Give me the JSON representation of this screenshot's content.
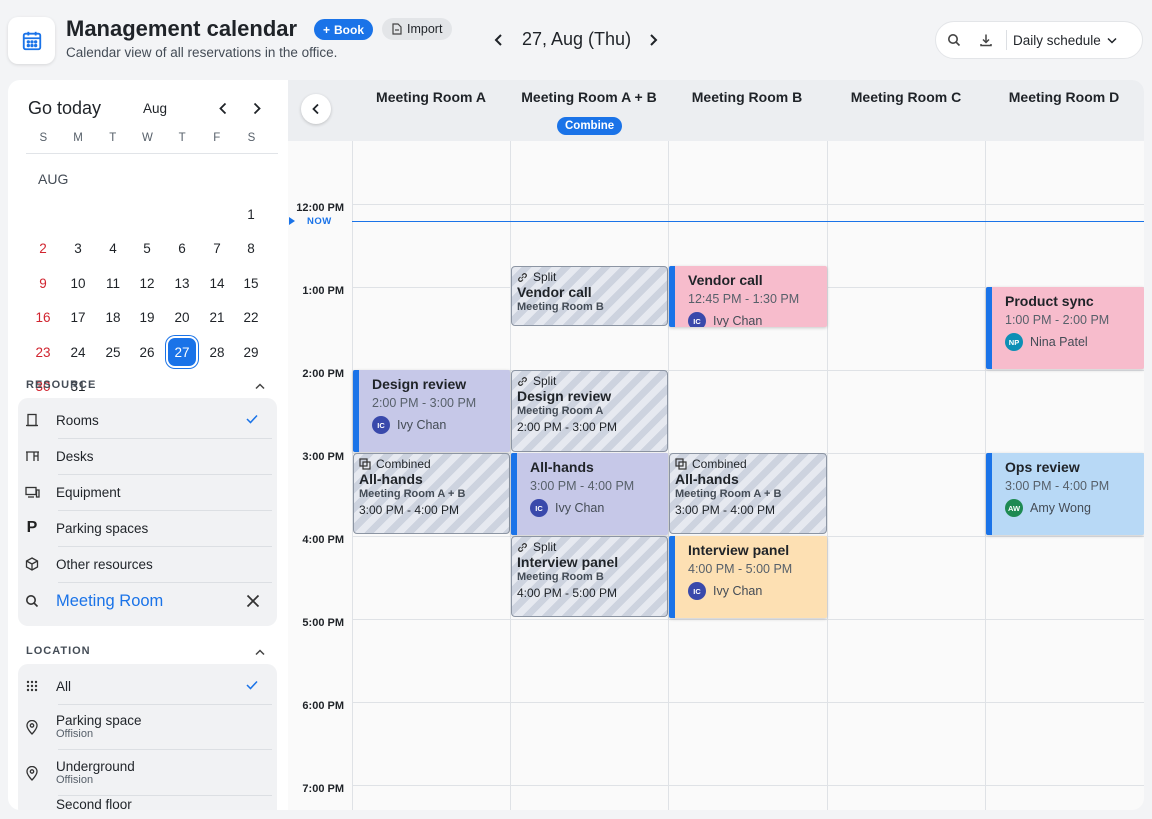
{
  "header": {
    "title": "Management calendar",
    "subtitle": "Calendar view of all reservations in the office.",
    "book_label": "Book",
    "import_label": "Import",
    "date": "27, Aug (Thu)",
    "view_select": "Daily schedule",
    "icons": [
      "calendar-icon",
      "plus-icon",
      "file-icon",
      "chevron-left-icon",
      "chevron-right-icon",
      "search-icon",
      "download-icon",
      "chevron-down-icon"
    ]
  },
  "mini_calendar": {
    "go_today": "Go today",
    "month_select": "Aug",
    "weekdays": [
      "S",
      "M",
      "T",
      "W",
      "T",
      "F",
      "S"
    ],
    "month_tag": "AUG",
    "selected_day": "27",
    "accent": "#1a73e8",
    "sunday_color": "#d1242f"
  },
  "resource": {
    "label": "RESOURCE",
    "items": [
      {
        "label": "Rooms",
        "icon": "door-icon",
        "checked": true
      },
      {
        "label": "Desks",
        "icon": "desk-icon",
        "checked": false
      },
      {
        "label": "Equipment",
        "icon": "monitor-icon",
        "checked": false
      },
      {
        "label": "Parking spaces",
        "icon": "parking-icon",
        "checked": false
      },
      {
        "label": "Other resources",
        "icon": "box-icon",
        "checked": false
      }
    ],
    "search_value": "Meeting Room"
  },
  "location": {
    "label": "LOCATION",
    "items": [
      {
        "label": "All",
        "sub": "",
        "icon": "grid-dots-icon",
        "checked": true
      },
      {
        "label": "Parking space",
        "sub": "Offision",
        "icon": "pin-icon"
      },
      {
        "label": "Underground",
        "sub": "Offision",
        "icon": "pin-icon"
      },
      {
        "label": "Second floor",
        "sub": "",
        "icon": "pin-icon"
      }
    ]
  },
  "calendar": {
    "rooms": [
      "Meeting Room A",
      "Meeting Room A + B",
      "Meeting Room B",
      "Meeting Room C",
      "Meeting Room D"
    ],
    "combine_label": "Combine",
    "times": [
      "12:00 PM",
      "1:00 PM",
      "2:00 PM",
      "3:00 PM",
      "4:00 PM",
      "5:00 PM",
      "6:00 PM",
      "7:00 PM"
    ],
    "now_label": "NOW",
    "events": {
      "vendor_call_b": {
        "title": "Vendor call",
        "time": "12:45 PM - 1:30 PM",
        "initials": "IC",
        "person": "Ivy Chan"
      },
      "product_sync": {
        "title": "Product sync",
        "time": "1:00 PM - 2:00 PM",
        "initials": "NP",
        "person": "Nina Patel"
      },
      "design_review_a": {
        "title": "Design review",
        "time": "2:00 PM - 3:00 PM",
        "initials": "IC",
        "person": "Ivy Chan"
      },
      "all_hands_ab": {
        "title": "All-hands",
        "time": "3:00 PM - 4:00 PM",
        "initials": "IC",
        "person": "Ivy Chan"
      },
      "ops_review": {
        "title": "Ops review",
        "time": "3:00 PM - 4:00 PM",
        "initials": "AW",
        "person": "Amy Wong"
      },
      "interview_b": {
        "title": "Interview panel",
        "time": "4:00 PM - 5:00 PM",
        "initials": "IC",
        "person": "Ivy Chan"
      },
      "split_vendor": {
        "tag": "Split",
        "title": "Vendor call",
        "room": "Meeting Room B",
        "time": ""
      },
      "split_design": {
        "tag": "Split",
        "title": "Design review",
        "room": "Meeting Room A",
        "time": "2:00 PM - 3:00 PM"
      },
      "split_interview": {
        "tag": "Split",
        "title": "Interview panel",
        "room": "Meeting Room B",
        "time": "4:00 PM - 5:00 PM"
      },
      "combined_a": {
        "tag": "Combined",
        "title": "All-hands",
        "room": "Meeting Room A + B",
        "time": "3:00 PM - 4:00 PM"
      },
      "combined_b": {
        "tag": "Combined",
        "title": "All-hands",
        "room": "Meeting Room A + B",
        "time": "3:00 PM - 4:00 PM"
      }
    },
    "colors": {
      "pink": "#f7bccc",
      "lavender": "#c6c8e8",
      "blue": "#b8d9f6",
      "peach": "#fde0b3",
      "avatar_ic": "#3949ab",
      "avatar_np": "#0d8fb5",
      "avatar_aw": "#1e8a52"
    }
  }
}
